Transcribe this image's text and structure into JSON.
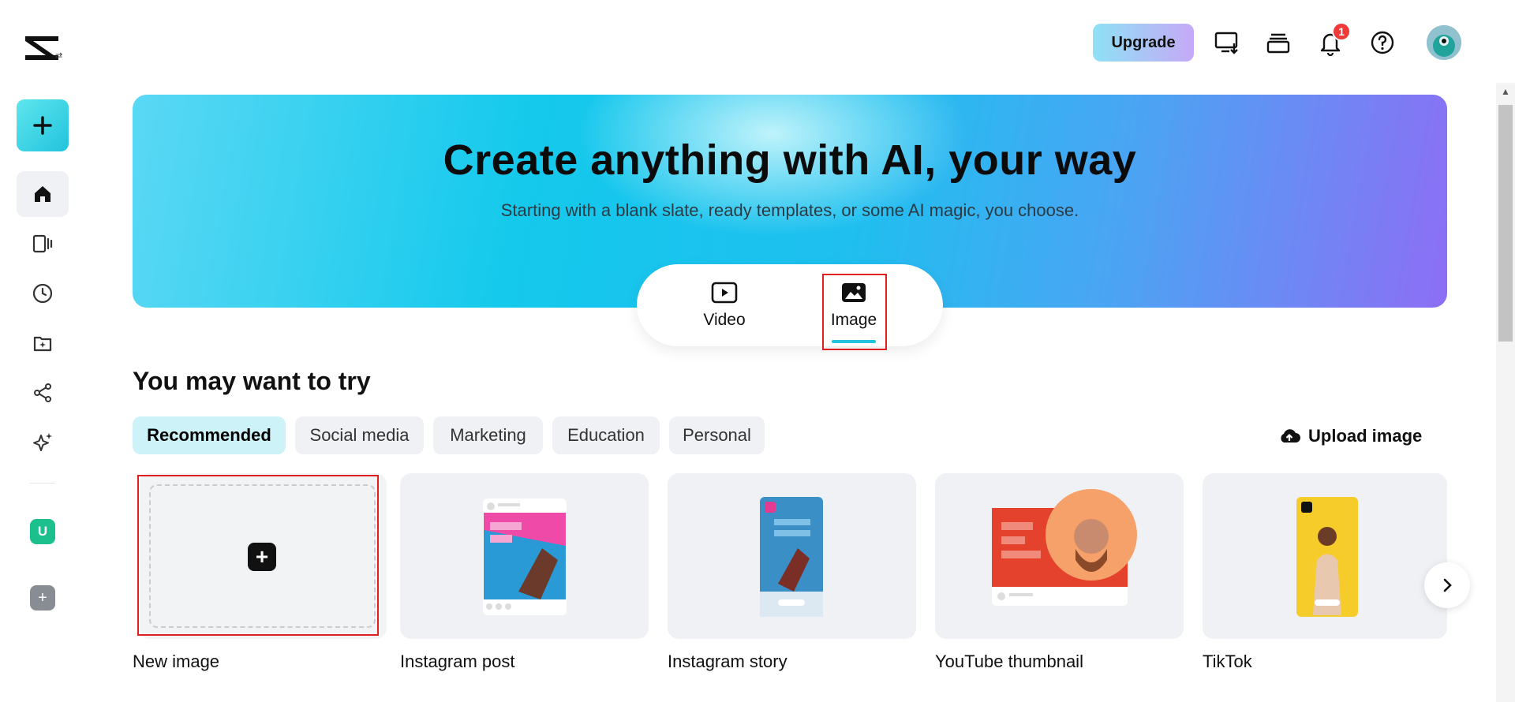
{
  "app": {
    "name": "CapCut"
  },
  "topbar": {
    "upgrade_label": "Upgrade",
    "notification_count": "1"
  },
  "hero": {
    "title": "Create anything with AI, your way",
    "subtitle": "Starting with a blank slate, ready templates, or some AI magic, you choose."
  },
  "modes": [
    {
      "label": "Video",
      "icon": "video-play-icon",
      "selected": false
    },
    {
      "label": "Image",
      "icon": "image-icon",
      "selected": true
    }
  ],
  "section": {
    "title": "You may want to try"
  },
  "chips": [
    {
      "label": "Recommended",
      "active": true
    },
    {
      "label": "Social media",
      "active": false
    },
    {
      "label": "Marketing",
      "active": false
    },
    {
      "label": "Education",
      "active": false
    },
    {
      "label": "Personal",
      "active": false
    }
  ],
  "upload": {
    "label": "Upload image"
  },
  "cards": [
    {
      "label": "New image"
    },
    {
      "label": "Instagram post"
    },
    {
      "label": "Instagram story"
    },
    {
      "label": "YouTube thumbnail"
    },
    {
      "label": "TikTok"
    }
  ],
  "sidebar": {
    "workspace_initial": "U"
  },
  "colors": {
    "accent": "#22c3dd",
    "highlight": "#e02020",
    "badge": "#f03a3a"
  }
}
